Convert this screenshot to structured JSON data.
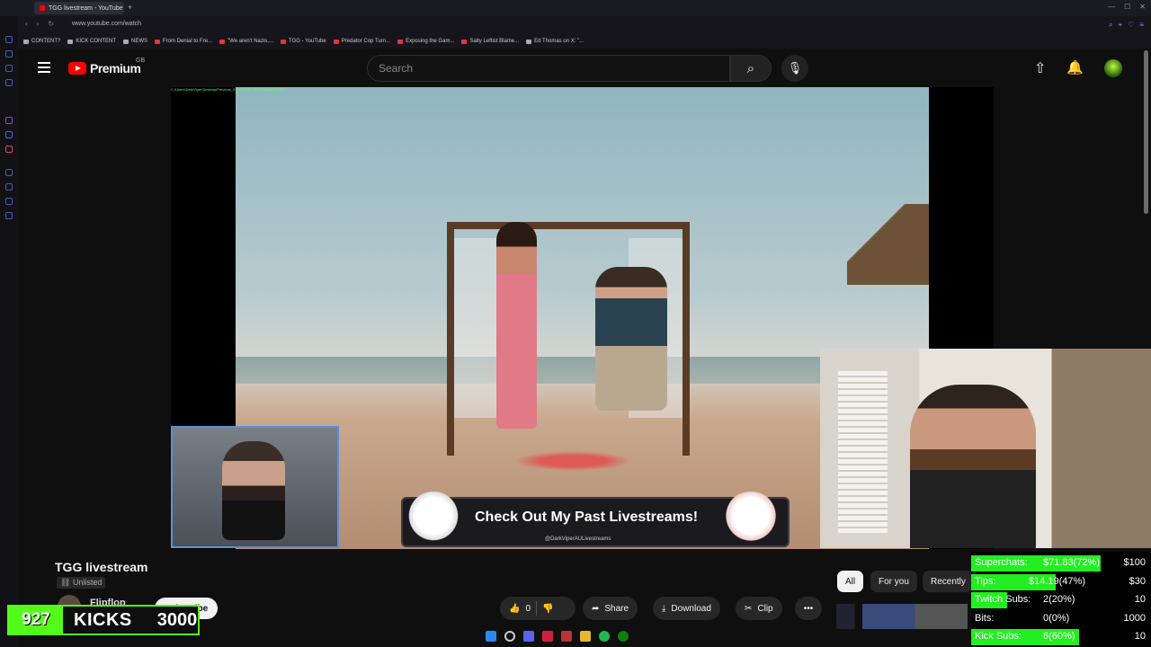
{
  "browser": {
    "tab_title": "TGG livestream - YouTube",
    "url": "www.youtube.com/watch",
    "bookmarks": [
      {
        "label": "CONTENT?",
        "red": false
      },
      {
        "label": "KICK CONTENT",
        "red": false
      },
      {
        "label": "NEWS",
        "red": false
      },
      {
        "label": "From Denial to Fre...",
        "red": true
      },
      {
        "label": "\"We aren't Nazis,...",
        "red": true
      },
      {
        "label": "TGG - YouTube",
        "red": true
      },
      {
        "label": "Predator Cop Turn...",
        "red": true
      },
      {
        "label": "Exposing the Gam...",
        "red": true
      },
      {
        "label": "Salty Leftist Blame...",
        "red": true
      },
      {
        "label": "Ed Thomas on X: \"...",
        "red": false
      }
    ]
  },
  "masthead": {
    "logo_text": "Premium",
    "region": "GB",
    "search_placeholder": "Search"
  },
  "video": {
    "path_overlay": "C:\\Users\\DarkViper\\Desktop\\Previous_01-11-2025_18-53-56.jpg (1/296)",
    "banner_title": "Check Out My Past Livestreams!",
    "banner_handle": "@DarkViperAULivestreams"
  },
  "below": {
    "title": "TGG livestream",
    "visibility": "Unlisted",
    "channel_name": "Flipflop",
    "subscribe_label": "Subscribe",
    "like_count": "0",
    "share_label": "Share",
    "download_label": "Download",
    "clip_label": "Clip",
    "chips": [
      "All",
      "For you",
      "Recently"
    ]
  },
  "kicks": {
    "count": "927",
    "label": "KICKS",
    "goal": "3000"
  },
  "goals": [
    {
      "label": "Superchats:",
      "amount": "$71.83(72%)",
      "target": "$100",
      "progress": 0.72
    },
    {
      "label": "Tips:",
      "amount": "$14.19(47%)",
      "target": "$30",
      "progress": 0.47
    },
    {
      "label": "Twitch Subs:",
      "amount": "2(20%)",
      "target": "10",
      "progress": 0.2
    },
    {
      "label": "Bits:",
      "amount": "0(0%)",
      "target": "1000",
      "progress": 0.0
    },
    {
      "label": "Kick Subs:",
      "amount": "6(60%)",
      "target": "10",
      "progress": 0.6
    }
  ],
  "colors": {
    "youtube_red": "#ff0000",
    "kick_green": "#53fc18",
    "goal_green": "#22ee22"
  }
}
